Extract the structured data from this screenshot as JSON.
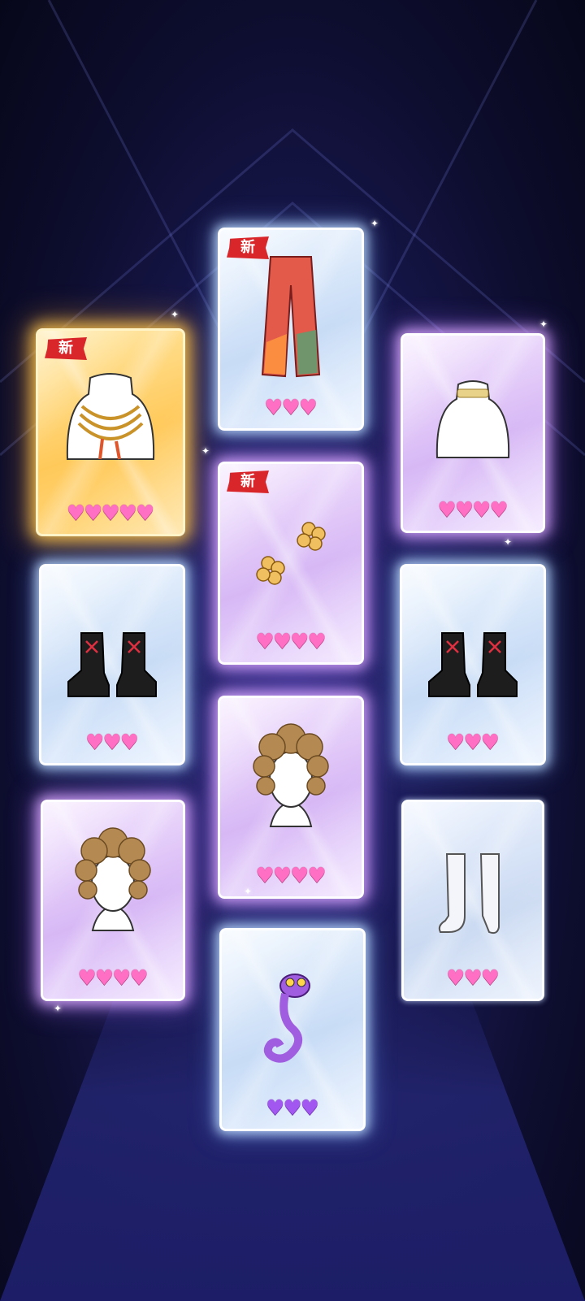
{
  "badge_new": "新",
  "colors": {
    "heart_pink": "#ff6fc4",
    "heart_violet": "#a257f0",
    "badge_red": "#d8262a"
  },
  "cards": [
    {
      "id": "necklace-gold",
      "rarity": "gold",
      "item": "gold-necklace-icon",
      "hearts": 5,
      "new": true
    },
    {
      "id": "pants-red",
      "rarity": "blue",
      "item": "red-pants-icon",
      "hearts": 3,
      "new": true
    },
    {
      "id": "choker",
      "rarity": "purple",
      "item": "choker-icon",
      "hearts": 4,
      "new": false
    },
    {
      "id": "earrings",
      "rarity": "purple",
      "item": "flower-earrings-icon",
      "hearts": 4,
      "new": true
    },
    {
      "id": "boots-left",
      "rarity": "blue",
      "item": "platform-boots-icon",
      "hearts": 3,
      "new": false
    },
    {
      "id": "boots-right",
      "rarity": "blue",
      "item": "platform-boots-icon",
      "hearts": 3,
      "new": false
    },
    {
      "id": "hair-center",
      "rarity": "purple",
      "item": "curly-hair-icon",
      "hearts": 4,
      "new": false
    },
    {
      "id": "hair-left",
      "rarity": "purple",
      "item": "curly-hair-icon",
      "hearts": 4,
      "new": false
    },
    {
      "id": "socks",
      "rarity": "plain",
      "item": "socks-icon",
      "hearts": 3,
      "new": false
    },
    {
      "id": "chameleon",
      "rarity": "blue",
      "item": "chameleon-icon",
      "hearts": 3,
      "new": false,
      "heart_color": "violet"
    }
  ]
}
